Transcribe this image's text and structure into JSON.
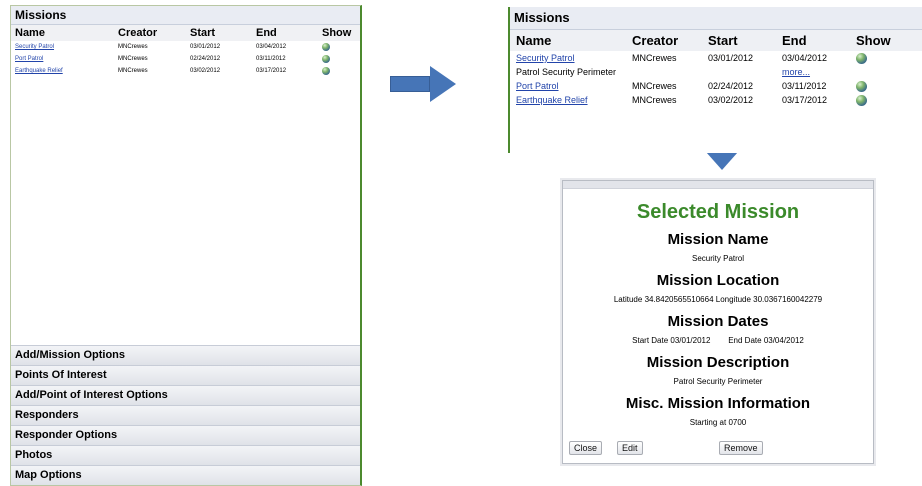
{
  "left_panel": {
    "title": "Missions",
    "columns": [
      "Name",
      "Creator",
      "Start",
      "End",
      "Show"
    ],
    "rows": [
      {
        "name": "Security Patrol",
        "creator": "MNCrewes",
        "start": "03/01/2012",
        "end": "03/04/2012"
      },
      {
        "name": "Port Patrol",
        "creator": "MNCrewes",
        "start": "02/24/2012",
        "end": "03/11/2012"
      },
      {
        "name": "Earthquake Relief",
        "creator": "MNCrewes",
        "start": "03/02/2012",
        "end": "03/17/2012"
      }
    ],
    "accordion": [
      "Add/Mission Options",
      "Points Of Interest",
      "Add/Point of Interest Options",
      "Responders",
      "Responder Options",
      "Photos",
      "Map Options"
    ]
  },
  "right_panel": {
    "title": "Missions",
    "columns": [
      "Name",
      "Creator",
      "Start",
      "End",
      "Show"
    ],
    "rows": [
      {
        "name": "Security Patrol",
        "creator": "MNCrewes",
        "start": "03/01/2012",
        "end": "03/04/2012"
      },
      {
        "description": "Patrol Security Perimeter",
        "more": "more..."
      },
      {
        "name": "Port Patrol",
        "creator": "MNCrewes",
        "start": "02/24/2012",
        "end": "03/11/2012"
      },
      {
        "name": "Earthquake Relief",
        "creator": "MNCrewes",
        "start": "03/02/2012",
        "end": "03/17/2012"
      }
    ]
  },
  "dialog": {
    "title": "Selected Mission",
    "mission_name_label": "Mission Name",
    "mission_name": "Security Patrol",
    "location_label": "Mission Location",
    "latitude_label": "Latitude",
    "latitude": "34.8420565510664",
    "longitude_label": "Longitude",
    "longitude": "30.0367160042279",
    "dates_label": "Mission Dates",
    "start_date_label": "Start Date",
    "start_date": "03/01/2012",
    "end_date_label": "End Date",
    "end_date": "03/04/2012",
    "description_label": "Mission Description",
    "description": "Patrol Security Perimeter",
    "misc_label": "Misc. Mission Information",
    "misc": "Starting at 0700",
    "buttons": {
      "close": "Close",
      "edit": "Edit",
      "remove": "Remove"
    }
  },
  "colors": {
    "accent_green": "#3b8a2b",
    "arrow_blue": "#4675b7",
    "link_blue": "#2244aa"
  },
  "icons": {
    "show": "globe-icon",
    "arrow_right": "arrow-right-icon",
    "arrow_down": "arrow-down-icon"
  }
}
